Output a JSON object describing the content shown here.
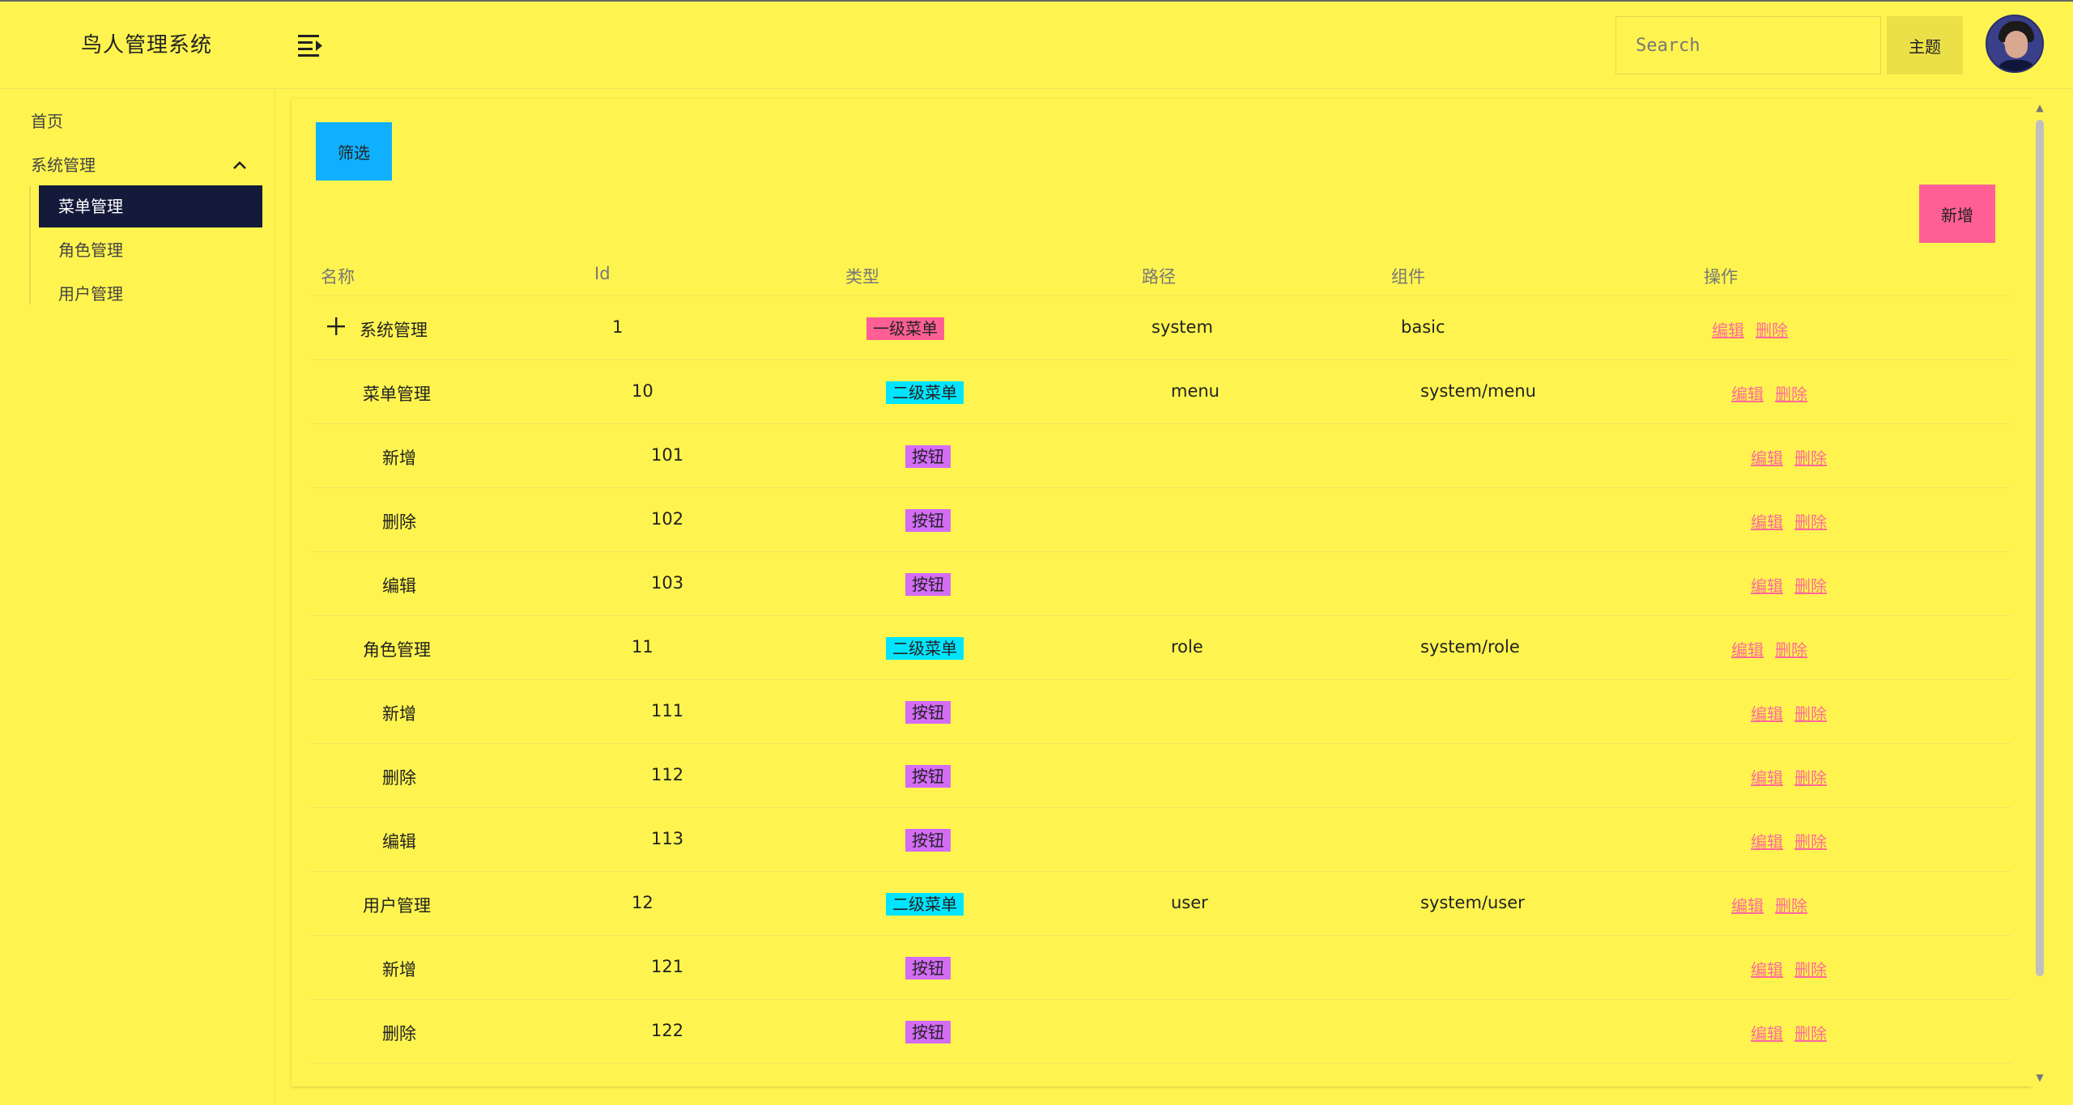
{
  "app": {
    "title": "鸟人管理系统"
  },
  "header": {
    "search_placeholder": "Search",
    "theme_label": "主题"
  },
  "sidebar": {
    "home": "首页",
    "system": "系统管理",
    "sub_items": [
      "菜单管理",
      "角色管理",
      "用户管理"
    ],
    "active_index": 0
  },
  "toolbar": {
    "filter_label": "筛选",
    "add_label": "新增"
  },
  "table": {
    "headers": [
      "名称",
      "Id",
      "类型",
      "路径",
      "组件",
      "操作"
    ],
    "edit_label": "编辑",
    "delete_label": "删除",
    "rows": [
      {
        "level": 0,
        "name": "系统管理",
        "id": "1",
        "type": "一级菜单",
        "path": "system",
        "component": "basic",
        "type_color": "#ff5f95"
      },
      {
        "level": 1,
        "name": "菜单管理",
        "id": "10",
        "type": "二级菜单",
        "path": "menu",
        "component": "system/menu",
        "type_color": "#00e5ff"
      },
      {
        "level": 2,
        "name": "新增",
        "id": "101",
        "type": "按钮",
        "path": "",
        "component": "",
        "type_color": "#d46cf7"
      },
      {
        "level": 2,
        "name": "删除",
        "id": "102",
        "type": "按钮",
        "path": "",
        "component": "",
        "type_color": "#d46cf7"
      },
      {
        "level": 2,
        "name": "编辑",
        "id": "103",
        "type": "按钮",
        "path": "",
        "component": "",
        "type_color": "#d46cf7"
      },
      {
        "level": 1,
        "name": "角色管理",
        "id": "11",
        "type": "二级菜单",
        "path": "role",
        "component": "system/role",
        "type_color": "#00e5ff"
      },
      {
        "level": 2,
        "name": "新增",
        "id": "111",
        "type": "按钮",
        "path": "",
        "component": "",
        "type_color": "#d46cf7"
      },
      {
        "level": 2,
        "name": "删除",
        "id": "112",
        "type": "按钮",
        "path": "",
        "component": "",
        "type_color": "#d46cf7"
      },
      {
        "level": 2,
        "name": "编辑",
        "id": "113",
        "type": "按钮",
        "path": "",
        "component": "",
        "type_color": "#d46cf7"
      },
      {
        "level": 1,
        "name": "用户管理",
        "id": "12",
        "type": "二级菜单",
        "path": "user",
        "component": "system/user",
        "type_color": "#00e5ff"
      },
      {
        "level": 2,
        "name": "新增",
        "id": "121",
        "type": "按钮",
        "path": "",
        "component": "",
        "type_color": "#d46cf7"
      },
      {
        "level": 2,
        "name": "删除",
        "id": "122",
        "type": "按钮",
        "path": "",
        "component": "",
        "type_color": "#d46cf7"
      }
    ]
  },
  "colors": {
    "background": "#fff44f",
    "active_nav": "#141a3a",
    "filter": "#10b0ff",
    "add": "#ff5f95",
    "link": "#ff6b9a"
  }
}
